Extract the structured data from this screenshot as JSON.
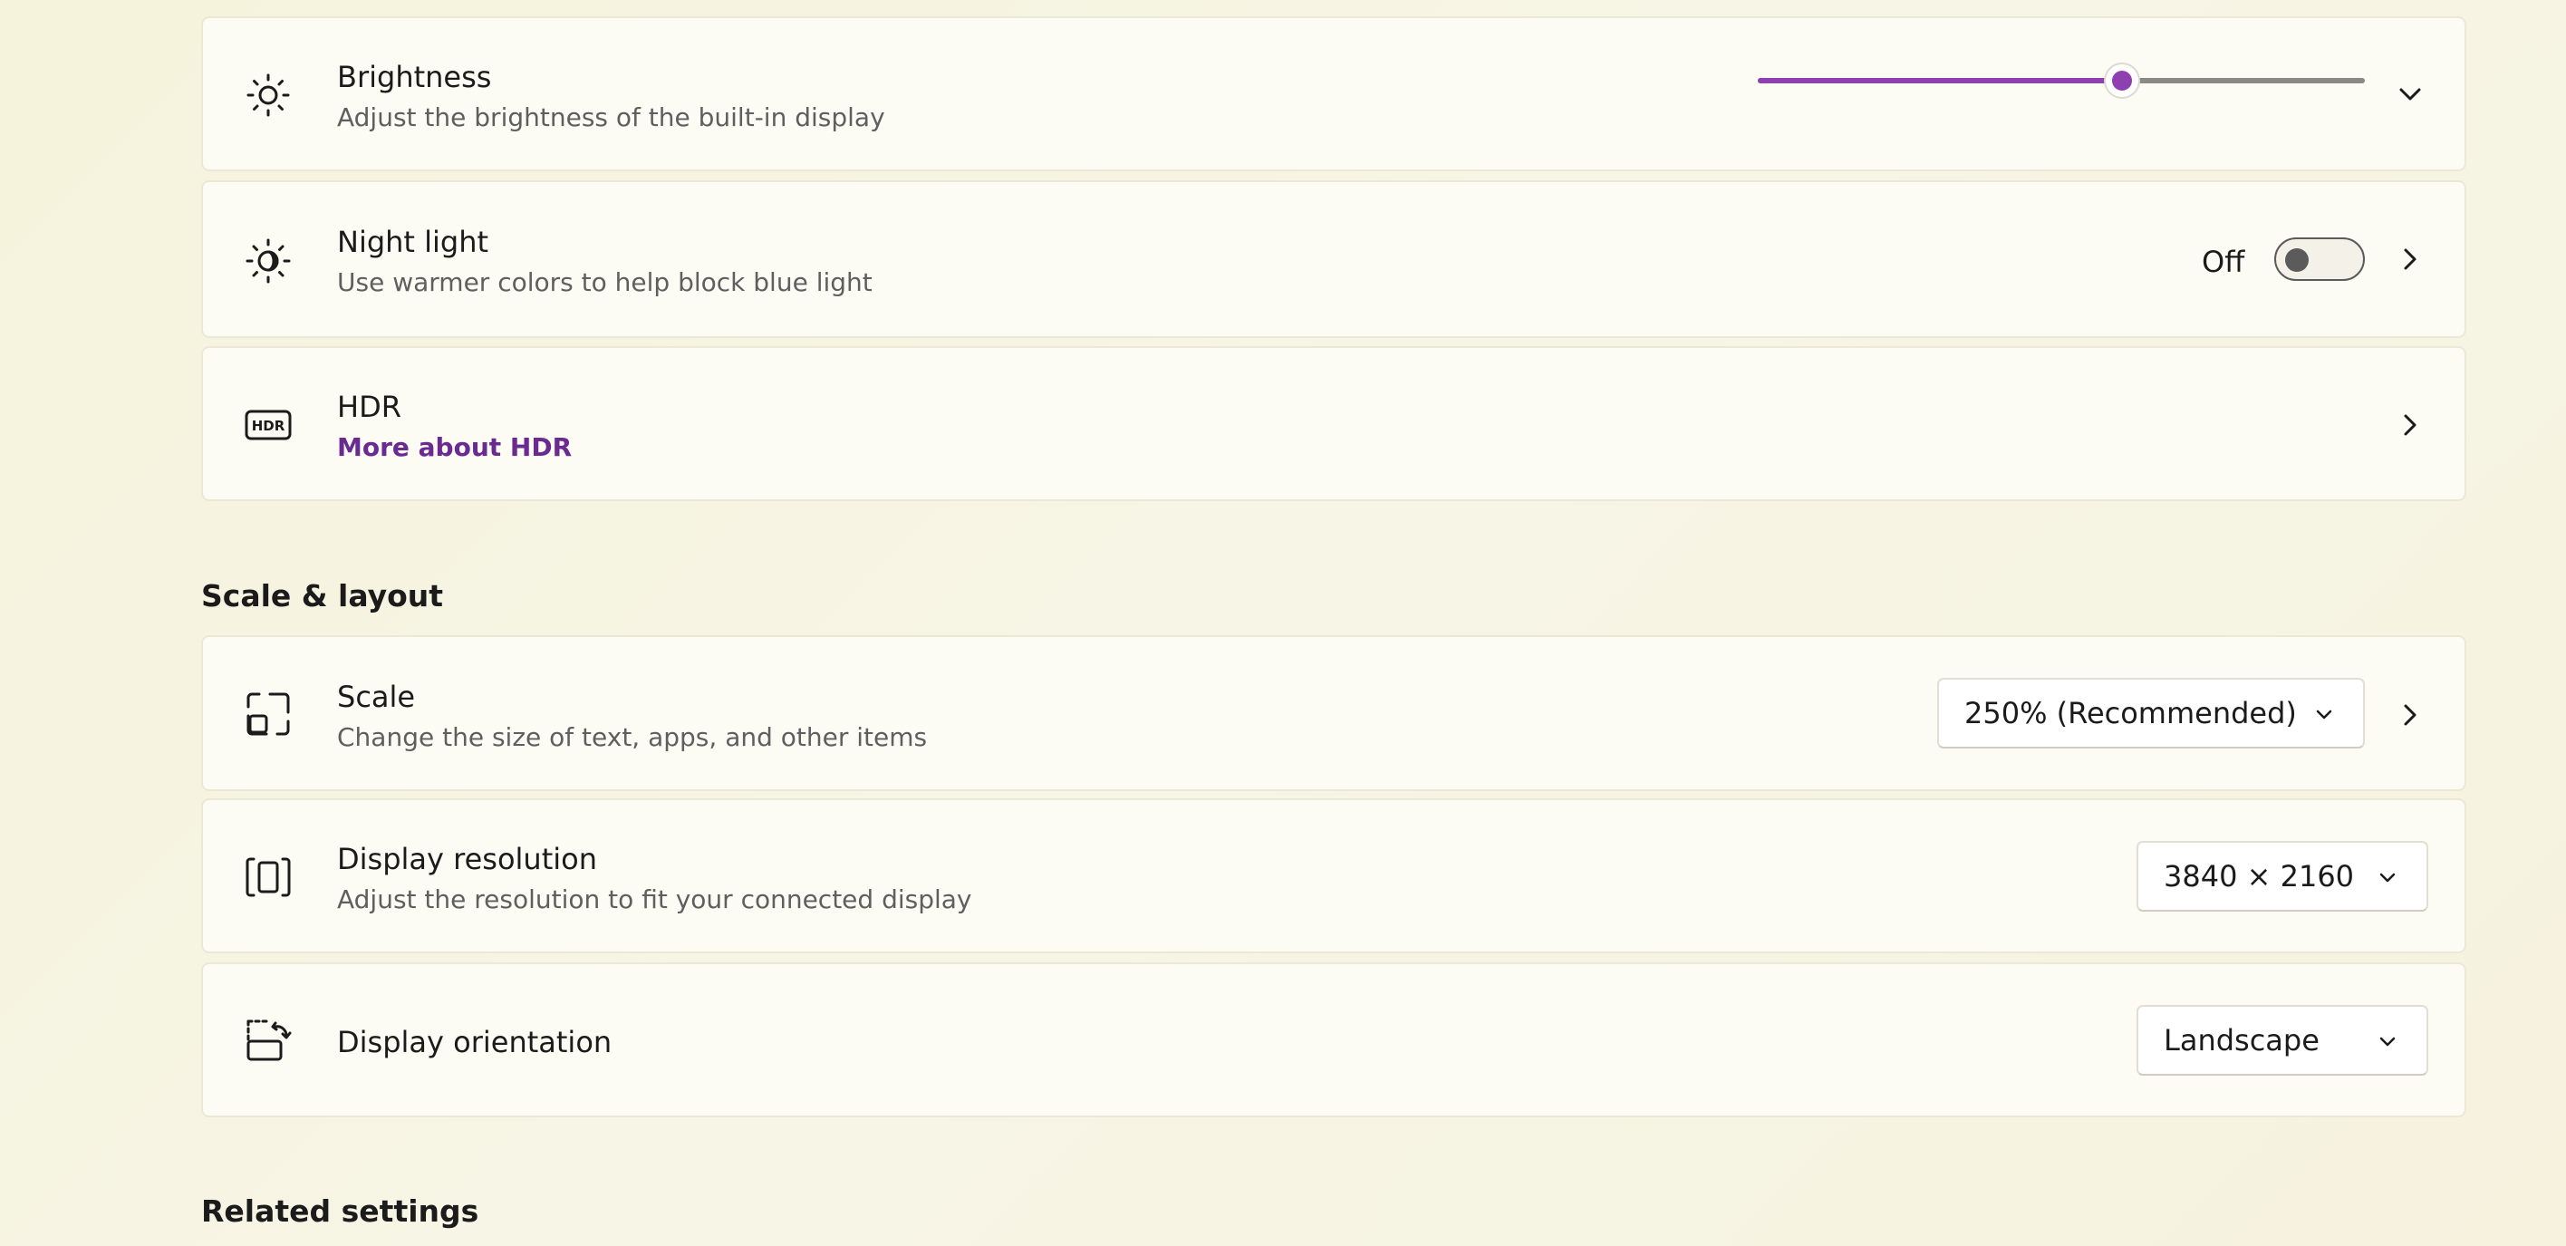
{
  "display": {
    "brightness": {
      "title": "Brightness",
      "subtitle": "Adjust the brightness of the built-in display",
      "icon": "sun-icon",
      "value_percent": 60,
      "accent_color": "#8e3fb0"
    },
    "night_light": {
      "title": "Night light",
      "subtitle": "Use warmer colors to help block blue light",
      "icon": "night-light-icon",
      "toggle_state": "Off"
    },
    "hdr": {
      "title": "HDR",
      "link": "More about HDR",
      "icon": "hdr-icon",
      "link_color": "#6a2a8f"
    }
  },
  "scale_layout": {
    "header": "Scale & layout",
    "scale": {
      "title": "Scale",
      "subtitle": "Change the size of text, apps, and other items",
      "icon": "scale-icon",
      "selected": "250% (Recommended)"
    },
    "resolution": {
      "title": "Display resolution",
      "subtitle": "Adjust the resolution to fit your connected display",
      "icon": "resolution-icon",
      "selected": "3840 × 2160"
    },
    "orientation": {
      "title": "Display orientation",
      "icon": "orientation-icon",
      "selected": "Landscape"
    }
  },
  "related": {
    "header": "Related settings"
  }
}
